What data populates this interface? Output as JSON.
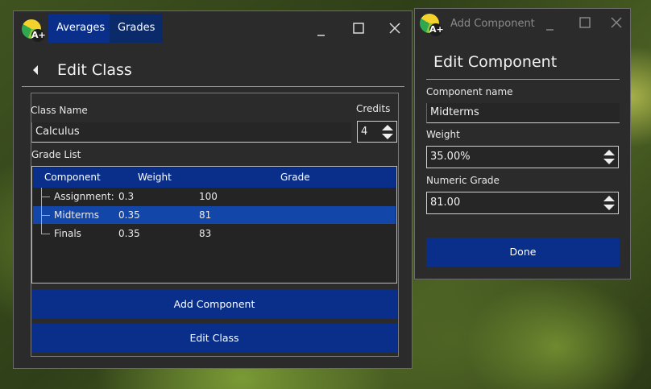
{
  "main_window": {
    "tabs": [
      {
        "label": "Averages"
      },
      {
        "label": "Grades"
      }
    ],
    "logo_text": "A+",
    "page_title": "Edit Class",
    "class_name_label": "Class Name",
    "class_name_value": "Calculus",
    "credits_label": "Credits",
    "credits_value": "4",
    "grade_list_label": "Grade List",
    "tree": {
      "columns": [
        "Component",
        "Weight",
        "Grade"
      ],
      "rows": [
        {
          "component": "Assignment:",
          "weight": "0.3",
          "grade": "100"
        },
        {
          "component": "Midterms",
          "weight": "0.35",
          "grade": "81"
        },
        {
          "component": "Finals",
          "weight": "0.35",
          "grade": "83"
        }
      ]
    },
    "add_component_label": "Add Component",
    "edit_class_label": "Edit Class"
  },
  "component_window": {
    "window_title": "Add Component",
    "logo_text": "A+",
    "page_title": "Edit Component",
    "name_label": "Component name",
    "name_value": "Midterms",
    "weight_label": "Weight",
    "weight_value": "35.00%",
    "numeric_grade_label": "Numeric Grade",
    "numeric_grade_value": "81.00",
    "done_label": "Done"
  },
  "colors": {
    "accent": "#0a2f8a",
    "selection": "#1246a8",
    "window_bg": "#2b2b2b"
  },
  "icons": [
    "logo-icon",
    "minimize-icon",
    "maximize-icon",
    "close-icon",
    "back-arrow-icon",
    "spin-arrows-icon",
    "tree-branch-icon"
  ]
}
